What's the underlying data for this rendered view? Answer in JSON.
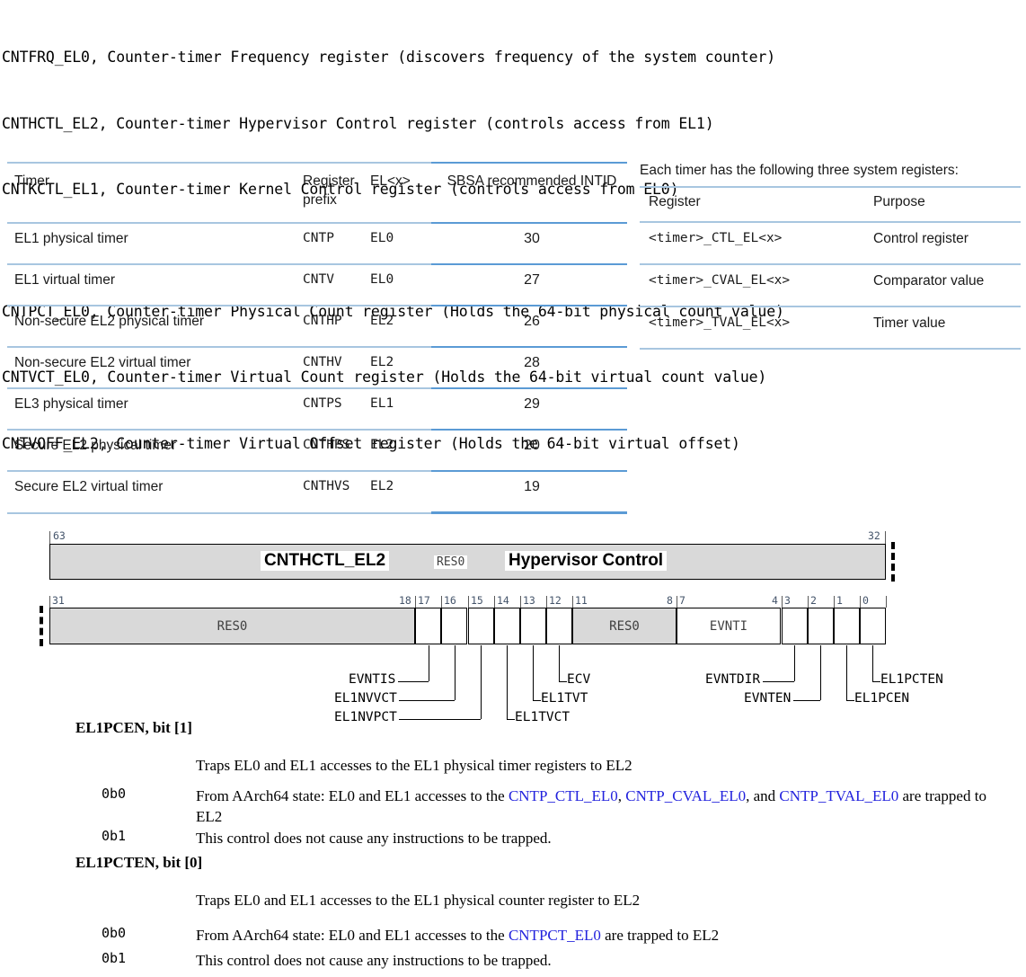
{
  "register_list": {
    "group1": [
      "CNTFRQ_EL0, Counter-timer Frequency register (discovers frequency of the system counter)",
      "CNTHCTL_EL2, Counter-timer Hypervisor Control register (controls access from EL1)",
      "CNTKCTL_EL1, Counter-timer Kernel Control register (controls access from EL0)"
    ],
    "group2": [
      "CNTPCT_EL0, Counter-timer Physical Count register (Holds the 64-bit physical count value)",
      "CNTVCT_EL0, Counter-timer Virtual Count register (Holds the 64-bit virtual count value)",
      "CNTVOFF_EL2, Counter-timer Virtual Offset register (Holds the 64-bit virtual offset)"
    ]
  },
  "timers_table": {
    "headers": [
      "Timer",
      "Register prefix",
      "EL<x>",
      "SBSA recommended INTID"
    ],
    "header_parts": {
      "timer": "Timer",
      "register": "Register",
      "prefix": "prefix",
      "elx": "EL<x>",
      "sbsa": "SBSA recommended",
      "intid": "INTID"
    },
    "rows": [
      {
        "timer": "EL1 physical timer",
        "prefix": "CNTP",
        "el": "EL0",
        "intid": "30"
      },
      {
        "timer": "EL1 virtual timer",
        "prefix": "CNTV",
        "el": "EL0",
        "intid": "27"
      },
      {
        "timer": "Non-secure EL2 physical timer",
        "prefix": "CNTHP",
        "el": "EL2",
        "intid": "26"
      },
      {
        "timer": "Non-secure EL2 virtual timer",
        "prefix": "CNTHV",
        "el": "EL2",
        "intid": "28"
      },
      {
        "timer": "EL3 physical timer",
        "prefix": "CNTPS",
        "el": "EL1",
        "intid": "29"
      },
      {
        "timer": "Secure EL2 physical timer",
        "prefix": "CNTHPS",
        "el": "EL2",
        "intid": "20"
      },
      {
        "timer": "Secure EL2 virtual timer",
        "prefix": "CNTHVS",
        "el": "EL2",
        "intid": "19"
      }
    ]
  },
  "registers_table": {
    "intro": "Each timer has the following three system registers:",
    "headers": {
      "register": "Register",
      "purpose": "Purpose"
    },
    "rows": [
      {
        "register": "<timer>_CTL_EL<x>",
        "purpose": "Control register"
      },
      {
        "register": "<timer>_CVAL_EL<x>",
        "purpose": "Comparator value"
      },
      {
        "register": "<timer>_TVAL_EL<x>",
        "purpose": "Timer value"
      }
    ]
  },
  "bitfield": {
    "upper": {
      "msb": "63",
      "lsb": "32",
      "res0": "RES0",
      "register_name": "CNTHCTL_EL2",
      "register_desc": "Hypervisor Control"
    },
    "lower": {
      "tick_labels": [
        "31",
        "18",
        "17",
        "16",
        "15",
        "14",
        "13",
        "12",
        "11",
        "8",
        "7",
        "4",
        "3",
        "2",
        "1",
        "0"
      ],
      "cells": [
        {
          "label": "RES0",
          "hi": 31,
          "lo": 18,
          "shaded": true
        },
        {
          "label": "",
          "hi": 17,
          "lo": 17,
          "shaded": false
        },
        {
          "label": "",
          "hi": 16,
          "lo": 16,
          "shaded": false
        },
        {
          "label": "",
          "hi": 15,
          "lo": 15,
          "shaded": false
        },
        {
          "label": "",
          "hi": 14,
          "lo": 14,
          "shaded": false
        },
        {
          "label": "",
          "hi": 13,
          "lo": 13,
          "shaded": false
        },
        {
          "label": "",
          "hi": 12,
          "lo": 12,
          "shaded": false
        },
        {
          "label": "RES0",
          "hi": 11,
          "lo": 8,
          "shaded": true
        },
        {
          "label": "EVNTI",
          "hi": 7,
          "lo": 4,
          "shaded": false
        },
        {
          "label": "",
          "hi": 3,
          "lo": 3,
          "shaded": false
        },
        {
          "label": "",
          "hi": 2,
          "lo": 2,
          "shaded": false
        },
        {
          "label": "",
          "hi": 1,
          "lo": 1,
          "shaded": false
        },
        {
          "label": "",
          "hi": 0,
          "lo": 0,
          "shaded": false
        }
      ],
      "callouts": [
        {
          "name": "EVNTIS",
          "bit": 17
        },
        {
          "name": "EL1NVVCT",
          "bit": 16
        },
        {
          "name": "EL1NVPCT",
          "bit": 15
        },
        {
          "name": "EL1TVCT",
          "bit": 14
        },
        {
          "name": "EL1TVT",
          "bit": 13
        },
        {
          "name": "ECV",
          "bit": 12
        },
        {
          "name": "EVNTDIR",
          "bit": 3
        },
        {
          "name": "EVNTEN",
          "bit": 2
        },
        {
          "name": "EL1PCEN",
          "bit": 1
        },
        {
          "name": "EL1PCTEN",
          "bit": 0
        }
      ]
    }
  },
  "field_descriptions": [
    {
      "title": "EL1PCEN, bit [1]",
      "lead": "Traps EL0 and EL1 accesses to the EL1 physical timer registers to EL2",
      "values": [
        {
          "code": "0b0",
          "text_pre": "From AArch64 state: EL0 and EL1 accesses to the ",
          "links": [
            "CNTP_CTL_EL0",
            "CNTP_CVAL_EL0",
            "CNTP_TVAL_EL0"
          ],
          "sep1": ", ",
          "sep2": ", and ",
          "text_post": " are trapped to EL2"
        },
        {
          "code": "0b1",
          "text_plain": "This control does not cause any instructions to be trapped."
        }
      ]
    },
    {
      "title": "EL1PCTEN, bit [0]",
      "lead": "Traps EL0 and EL1 accesses to the EL1 physical counter register to EL2",
      "values": [
        {
          "code": "0b0",
          "text_pre": "From AArch64 state: EL0 and EL1 accesses to the ",
          "links": [
            "CNTPCT_EL0"
          ],
          "text_post": " are trapped to EL2"
        },
        {
          "code": "0b1",
          "text_plain": "This control does not cause any instructions to be trapped."
        }
      ]
    }
  ],
  "colors": {
    "link": "#2222DD",
    "table_rule_light": "#A8C6E0",
    "table_rule_dark": "#5B9BD5",
    "res0_fill": "#D9D9D9",
    "bit_number": "#44546A"
  }
}
